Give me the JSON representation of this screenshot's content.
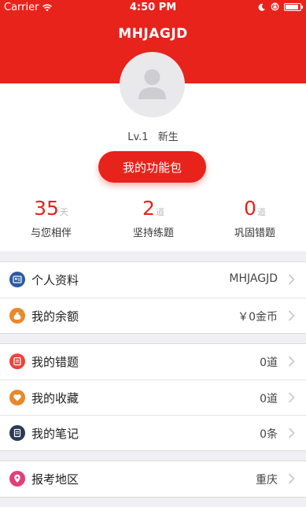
{
  "status_bar": {
    "carrier": "Carrier",
    "time": "4:50 PM"
  },
  "nav": {
    "title": "MHJAGJD"
  },
  "profile": {
    "level": "Lv.1",
    "rank": "新生",
    "button_label": "我的功能包"
  },
  "stats": [
    {
      "value": "35",
      "unit": "天",
      "label": "与您相伴"
    },
    {
      "value": "2",
      "unit": "道",
      "label": "坚持练题"
    },
    {
      "value": "0",
      "unit": "道",
      "label": "巩固错题"
    }
  ],
  "group1": [
    {
      "label": "个人资料",
      "value": "MHJAGJD",
      "icon": "profile-card-icon",
      "color": "#2e5a9e"
    },
    {
      "label": "我的余额",
      "value": "￥0金币",
      "icon": "money-bag-icon",
      "color": "#e8892b"
    }
  ],
  "group2": [
    {
      "label": "我的错题",
      "value": "0道",
      "icon": "wrong-questions-icon",
      "color": "#e8453a"
    },
    {
      "label": "我的收藏",
      "value": "0道",
      "icon": "heart-icon",
      "color": "#e8892b"
    },
    {
      "label": "我的笔记",
      "value": "0条",
      "icon": "notebook-icon",
      "color": "#2b3a56"
    }
  ],
  "group3": [
    {
      "label": "报考地区",
      "value": "重庆",
      "icon": "location-pin-icon",
      "color": "#e0407a"
    }
  ],
  "colors": {
    "brand": "#e8231b",
    "background": "#efeff4"
  }
}
